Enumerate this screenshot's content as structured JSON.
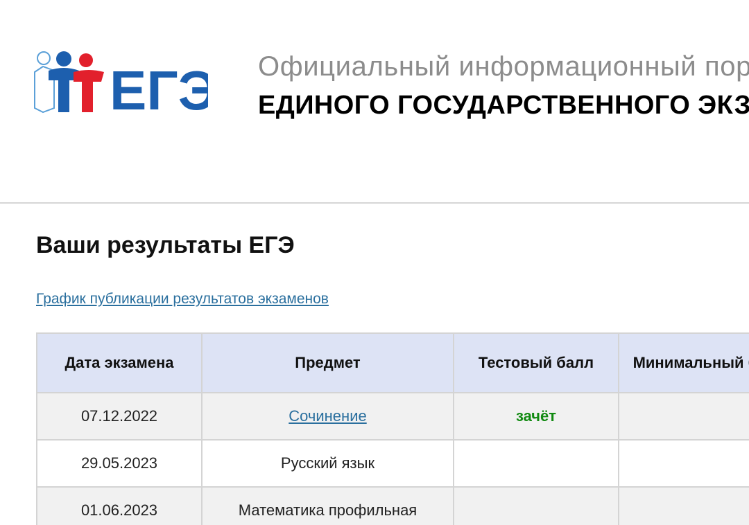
{
  "header": {
    "subtitle": "Официальный информационный портал",
    "title": "ЕДИНОГО ГОСУДАРСТВЕННОГО ЭКЗАМЕНА",
    "logo_text": "ЕГЭ",
    "logo_icon": "ege-people-logo-icon"
  },
  "main": {
    "heading": "Ваши результаты ЕГЭ",
    "schedule_link": "График публикации результатов экзаменов"
  },
  "table": {
    "columns": [
      "Дата экзамена",
      "Предмет",
      "Тестовый балл",
      "Минимальный балл"
    ],
    "rows": [
      {
        "date": "07.12.2022",
        "subject": "Сочинение",
        "score": "зачёт",
        "min_score": ""
      },
      {
        "date": "29.05.2023",
        "subject": "Русский язык",
        "score": "",
        "min_score": ""
      },
      {
        "date": "01.06.2023",
        "subject": "Математика профильная",
        "score": "",
        "min_score": ""
      }
    ]
  },
  "colors": {
    "logo_blue": "#1d5fae",
    "logo_red": "#e2202c",
    "link": "#2a6f9e",
    "pass": "#118a11",
    "table_header": "#dde3f5",
    "row_stripe": "#f1f1f1"
  }
}
